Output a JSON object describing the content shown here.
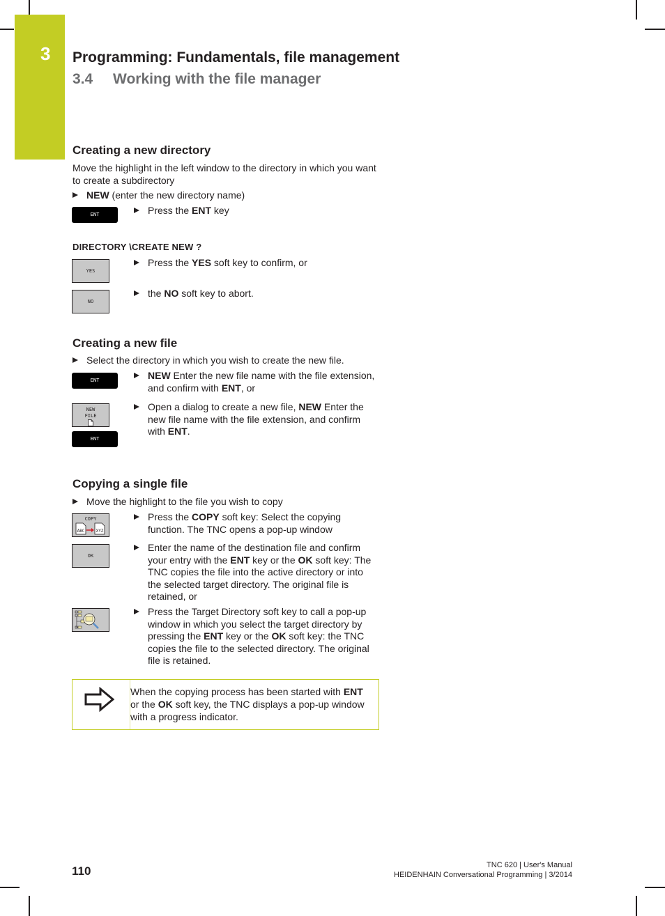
{
  "header": {
    "chapter_number": "3",
    "chapter_title": "Programming: Fundamentals, file management",
    "section_number": "3.4",
    "section_title": "Working with the file manager"
  },
  "colors": {
    "accent": "#c3cd24",
    "text": "#231f20",
    "section_gray": "#6d6e70",
    "softkey_gray": "#c8c8c8",
    "key_black": "#000000"
  },
  "new_directory": {
    "heading": "Creating a new directory",
    "intro": "Move the highlight in the left window to the directory in which you want to create a subdirectory",
    "step1_bold": "NEW",
    "step1_rest": " (enter the new directory name)",
    "ent_key_label": "ENT",
    "step2_pre": "Press the ",
    "step2_bold": "ENT",
    "step2_post": " key",
    "dialog_prompt": "DIRECTORY \\CREATE NEW ?",
    "yes_key_label": "YES",
    "step3_pre": "Press the ",
    "step3_bold": "YES",
    "step3_post": " soft key to confirm, or",
    "no_key_label": "NO",
    "step4_pre": "the ",
    "step4_bold": "NO",
    "step4_post": " soft key to abort."
  },
  "new_file": {
    "heading": "Creating a new file",
    "step1": "Select the directory in which you wish to create the new file.",
    "ent_key_label": "ENT",
    "step2_bold": "NEW",
    "step2_mid": " Enter the new file name with the file extension, and confirm with ",
    "step2_bold2": "ENT",
    "step2_post": ", or",
    "newfile_key_line1": "NEW",
    "newfile_key_line2": "FILE",
    "ent_key2_label": "ENT",
    "step3_pre": "Open a dialog to create a new file, ",
    "step3_bold": "NEW",
    "step3_mid": " Enter the new file name with the file extension, and confirm with ",
    "step3_bold2": "ENT",
    "step3_post": "."
  },
  "copy_file": {
    "heading": "Copying a single file",
    "step1": "Move the highlight to the file you wish to copy",
    "copy_key_label": "COPY",
    "copy_key_src": "ABC",
    "copy_key_dst": "XYZ",
    "step2_pre": "Press the ",
    "step2_bold": "COPY",
    "step2_post": " soft key: Select the copying function. The TNC opens a pop-up window",
    "ok_key_label": "OK",
    "step3_pre": "Enter the name of the destination file and confirm your entry with the ",
    "step3_bold": "ENT",
    "step3_mid": " key or the ",
    "step3_bold2": "OK",
    "step3_post": " soft key: The TNC copies the file into the active directory or into the selected target directory. The original file is retained, or",
    "target_dir_key_icon": "directory-tree-magnifier-icon",
    "step4_pre": "Press the Target Directory soft key to call a pop-up window in which you select the target directory by pressing the ",
    "step4_bold": "ENT",
    "step4_mid": " key or the ",
    "step4_bold2": "OK",
    "step4_post": " soft key: the TNC copies the file to the selected directory. The original file is retained."
  },
  "note": {
    "icon": "arrow-right-outline-icon",
    "text_pre": "When the copying process has been started with ",
    "text_bold": "ENT",
    "text_mid": " or the ",
    "text_bold2": "OK",
    "text_post": " soft key, the TNC displays a pop-up window with a progress indicator."
  },
  "footer": {
    "page_number": "110",
    "line1": "TNC 620 | User's Manual",
    "line2": "HEIDENHAIN Conversational Programming | 3/2014"
  }
}
